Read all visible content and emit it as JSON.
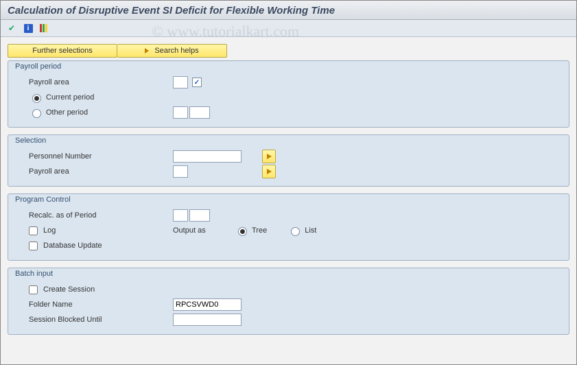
{
  "title": "Calculation of Disruptive Event SI Deficit for Flexible Working Time",
  "watermark": "© www.tutorialkart.com",
  "buttons": {
    "further_selections": "Further selections",
    "search_helps": "Search helps"
  },
  "groups": {
    "payroll_period": {
      "title": "Payroll period",
      "payroll_area_label": "Payroll area",
      "current_period_label": "Current period",
      "other_period_label": "Other period",
      "payroll_area_value": "",
      "other_period_v1": "",
      "other_period_v2": ""
    },
    "selection": {
      "title": "Selection",
      "personnel_number_label": "Personnel Number",
      "payroll_area_label": "Payroll area",
      "personnel_number_value": "",
      "payroll_area_value": ""
    },
    "program_control": {
      "title": "Program Control",
      "recalc_label": "Recalc. as of Period",
      "log_label": "Log",
      "db_update_label": "Database Update",
      "output_as_label": "Output as",
      "tree_label": "Tree",
      "list_label": "List",
      "recalc_v1": "",
      "recalc_v2": ""
    },
    "batch_input": {
      "title": "Batch input",
      "create_session_label": "Create Session",
      "folder_name_label": "Folder Name",
      "session_blocked_label": "Session Blocked Until",
      "folder_name_value": "RPCSVWD0",
      "session_blocked_value": ""
    }
  }
}
